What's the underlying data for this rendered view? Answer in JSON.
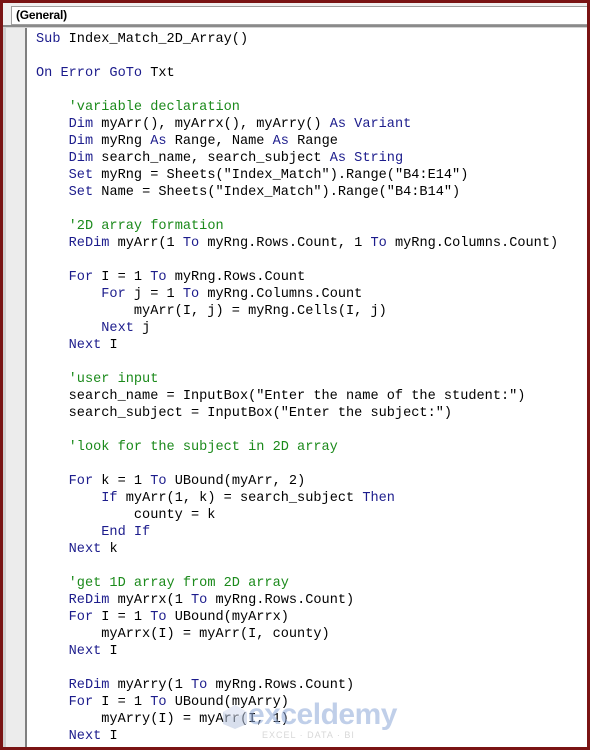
{
  "window": {
    "procedure_dropdown": {
      "selected": "(General)"
    }
  },
  "colors": {
    "keyword": "#1c1c8c",
    "comment": "#1b8a1b",
    "text": "#000000",
    "frame": "#7a1414"
  },
  "code_lines": [
    [
      {
        "t": "Sub",
        "k": "kw"
      },
      {
        "t": " Index_Match_2D_Array()"
      }
    ],
    [],
    [
      {
        "t": "On Error GoTo",
        "k": "kw"
      },
      {
        "t": " Txt"
      }
    ],
    [],
    [
      {
        "t": "    "
      },
      {
        "t": "'variable declaration",
        "k": "cm"
      }
    ],
    [
      {
        "t": "    "
      },
      {
        "t": "Dim",
        "k": "kw"
      },
      {
        "t": " myArr(), myArrx(), myArry() "
      },
      {
        "t": "As Variant",
        "k": "kw"
      }
    ],
    [
      {
        "t": "    "
      },
      {
        "t": "Dim",
        "k": "kw"
      },
      {
        "t": " myRng "
      },
      {
        "t": "As",
        "k": "kw"
      },
      {
        "t": " Range, Name "
      },
      {
        "t": "As",
        "k": "kw"
      },
      {
        "t": " Range"
      }
    ],
    [
      {
        "t": "    "
      },
      {
        "t": "Dim",
        "k": "kw"
      },
      {
        "t": " search_name, search_subject "
      },
      {
        "t": "As String",
        "k": "kw"
      }
    ],
    [
      {
        "t": "    "
      },
      {
        "t": "Set",
        "k": "kw"
      },
      {
        "t": " myRng = Sheets(\"Index_Match\").Range(\"B4:E14\")"
      }
    ],
    [
      {
        "t": "    "
      },
      {
        "t": "Set",
        "k": "kw"
      },
      {
        "t": " Name = Sheets(\"Index_Match\").Range(\"B4:B14\")"
      }
    ],
    [],
    [
      {
        "t": "    "
      },
      {
        "t": "'2D array formation",
        "k": "cm"
      }
    ],
    [
      {
        "t": "    "
      },
      {
        "t": "ReDim",
        "k": "kw"
      },
      {
        "t": " myArr(1 "
      },
      {
        "t": "To",
        "k": "kw"
      },
      {
        "t": " myRng.Rows.Count, 1 "
      },
      {
        "t": "To",
        "k": "kw"
      },
      {
        "t": " myRng.Columns.Count)"
      }
    ],
    [],
    [
      {
        "t": "    "
      },
      {
        "t": "For",
        "k": "kw"
      },
      {
        "t": " I = 1 "
      },
      {
        "t": "To",
        "k": "kw"
      },
      {
        "t": " myRng.Rows.Count"
      }
    ],
    [
      {
        "t": "        "
      },
      {
        "t": "For",
        "k": "kw"
      },
      {
        "t": " j = 1 "
      },
      {
        "t": "To",
        "k": "kw"
      },
      {
        "t": " myRng.Columns.Count"
      }
    ],
    [
      {
        "t": "            myArr(I, j) = myRng.Cells(I, j)"
      }
    ],
    [
      {
        "t": "        "
      },
      {
        "t": "Next",
        "k": "kw"
      },
      {
        "t": " j"
      }
    ],
    [
      {
        "t": "    "
      },
      {
        "t": "Next",
        "k": "kw"
      },
      {
        "t": " I"
      }
    ],
    [],
    [
      {
        "t": "    "
      },
      {
        "t": "'user input",
        "k": "cm"
      }
    ],
    [
      {
        "t": "    search_name = InputBox(\"Enter the name of the student:\")"
      }
    ],
    [
      {
        "t": "    search_subject = InputBox(\"Enter the subject:\")"
      }
    ],
    [],
    [
      {
        "t": "    "
      },
      {
        "t": "'look for the subject in 2D array",
        "k": "cm"
      }
    ],
    [],
    [
      {
        "t": "    "
      },
      {
        "t": "For",
        "k": "kw"
      },
      {
        "t": " k = 1 "
      },
      {
        "t": "To",
        "k": "kw"
      },
      {
        "t": " UBound(myArr, 2)"
      }
    ],
    [
      {
        "t": "        "
      },
      {
        "t": "If",
        "k": "kw"
      },
      {
        "t": " myArr(1, k) = search_subject "
      },
      {
        "t": "Then",
        "k": "kw"
      }
    ],
    [
      {
        "t": "            county = k"
      }
    ],
    [
      {
        "t": "        "
      },
      {
        "t": "End If",
        "k": "kw"
      }
    ],
    [
      {
        "t": "    "
      },
      {
        "t": "Next",
        "k": "kw"
      },
      {
        "t": " k"
      }
    ],
    [],
    [
      {
        "t": "    "
      },
      {
        "t": "'get 1D array from 2D array",
        "k": "cm"
      }
    ],
    [
      {
        "t": "    "
      },
      {
        "t": "ReDim",
        "k": "kw"
      },
      {
        "t": " myArrx(1 "
      },
      {
        "t": "To",
        "k": "kw"
      },
      {
        "t": " myRng.Rows.Count)"
      }
    ],
    [
      {
        "t": "    "
      },
      {
        "t": "For",
        "k": "kw"
      },
      {
        "t": " I = 1 "
      },
      {
        "t": "To",
        "k": "kw"
      },
      {
        "t": " UBound(myArrx)"
      }
    ],
    [
      {
        "t": "        myArrx(I) = myArr(I, county)"
      }
    ],
    [
      {
        "t": "    "
      },
      {
        "t": "Next",
        "k": "kw"
      },
      {
        "t": " I"
      }
    ],
    [],
    [
      {
        "t": "    "
      },
      {
        "t": "ReDim",
        "k": "kw"
      },
      {
        "t": " myArry(1 "
      },
      {
        "t": "To",
        "k": "kw"
      },
      {
        "t": " myRng.Rows.Count)"
      }
    ],
    [
      {
        "t": "    "
      },
      {
        "t": "For",
        "k": "kw"
      },
      {
        "t": " I = 1 "
      },
      {
        "t": "To",
        "k": "kw"
      },
      {
        "t": " UBound(myArry)"
      }
    ],
    [
      {
        "t": "        myArry(I) = myArr(I, 1)"
      }
    ],
    [
      {
        "t": "    "
      },
      {
        "t": "Next",
        "k": "kw"
      },
      {
        "t": " I"
      }
    ]
  ],
  "watermark": {
    "name": "exceldemy",
    "tagline": "EXCEL · DATA · BI"
  }
}
